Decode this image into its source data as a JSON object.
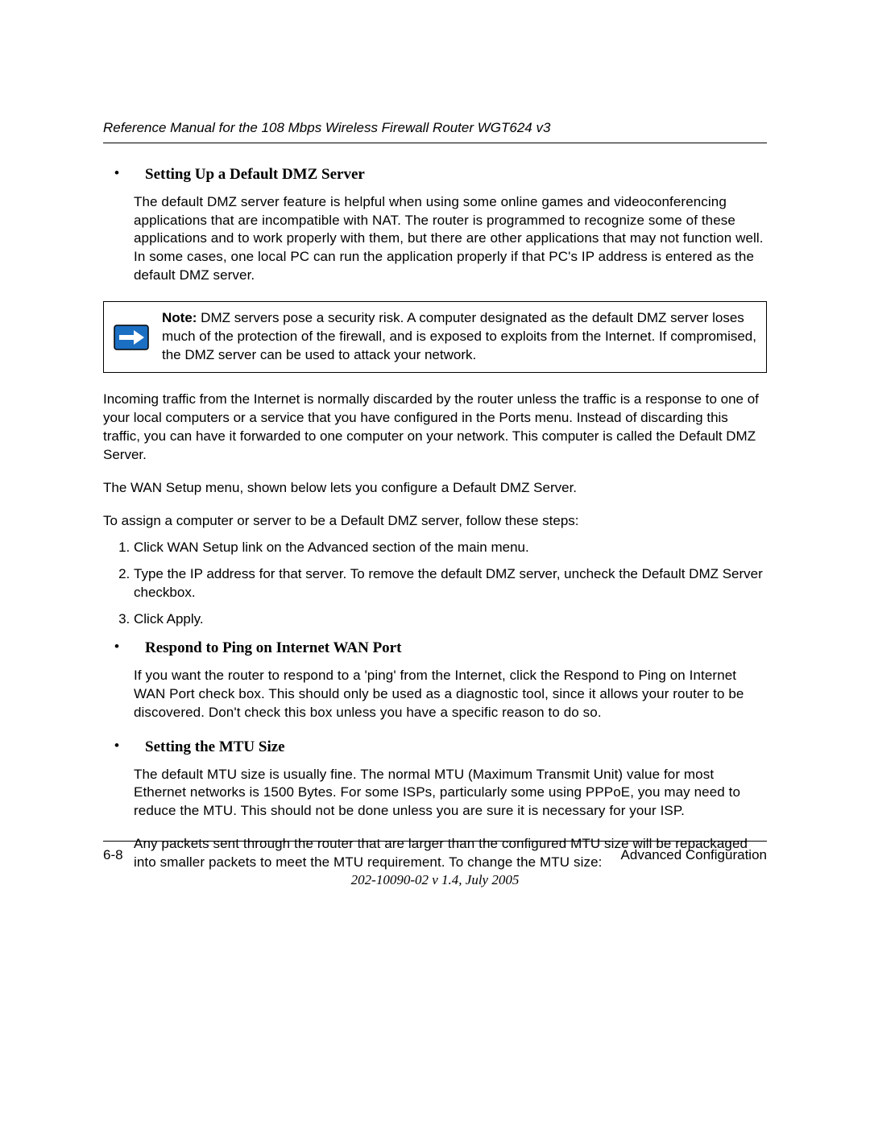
{
  "header": {
    "title": "Reference Manual for the 108 Mbps Wireless Firewall Router WGT624 v3"
  },
  "sections": {
    "dmz": {
      "heading": "Setting Up a Default DMZ Server",
      "para1": "The default DMZ server feature is helpful when using some online games and videoconferencing applications that are incompatible with NAT. The router is programmed to recognize some of these applications and to work properly with them, but there are other applications that may not function well. In some cases, one local PC can run the application properly if that PC's IP address is entered as the default DMZ server."
    },
    "note": {
      "label": "Note:",
      "text": " DMZ servers pose a security risk. A computer designated as the default DMZ server loses much of the protection of the firewall, and is exposed to exploits from the Internet. If compromised, the DMZ server can be used to attack your network."
    },
    "after_note": {
      "para1": "Incoming traffic from the Internet is normally discarded by the router unless the traffic is a response to one of your local computers or a service that you have configured in the Ports menu. Instead of discarding this traffic, you can have it forwarded to one computer on your network. This computer is called the Default DMZ Server.",
      "para2": "The WAN Setup menu, shown below lets you configure a Default DMZ Server.",
      "para3": "To assign a computer or server to be a Default DMZ server, follow these steps:"
    },
    "steps": {
      "s1": "Click WAN Setup link on the Advanced section of the main menu.",
      "s2": "Type the IP address for that server. To remove the default DMZ server, uncheck the Default DMZ Server checkbox.",
      "s3": "Click Apply."
    },
    "ping": {
      "heading": "Respond to Ping on Internet WAN Port",
      "para1": "If you want the router to respond to a 'ping' from the Internet, click the Respond to Ping on Internet WAN Port check box. This should only be used as a diagnostic tool, since it allows your router to be discovered. Don't check this box unless you have a specific reason to do so."
    },
    "mtu": {
      "heading": "Setting the MTU Size",
      "para1": "The default MTU size is usually fine. The normal MTU (Maximum Transmit Unit) value for most Ethernet networks is 1500 Bytes. For some ISPs, particularly some using PPPoE, you may need to reduce the MTU. This should not be done unless you are sure it is necessary for your ISP.",
      "para2": "Any packets sent through the router that are larger than the configured MTU size will be repackaged into smaller packets to meet the MTU requirement. To change the MTU size:"
    }
  },
  "footer": {
    "left": "6-8",
    "right": "Advanced Configuration",
    "center": "202-10090-02 v 1.4, July 2005"
  }
}
